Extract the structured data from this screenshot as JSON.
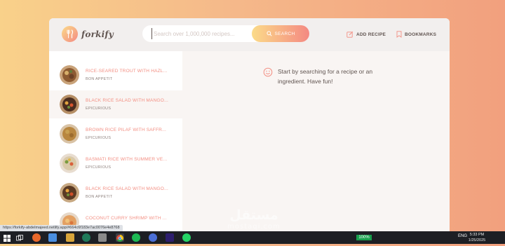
{
  "app": {
    "name": "forkify"
  },
  "search": {
    "placeholder": "Search over 1,000,000 recipes...",
    "button_label": "SEARCH"
  },
  "nav": {
    "add_recipe": "ADD RECIPE",
    "bookmarks": "BOOKMARKS"
  },
  "results": [
    {
      "title": "RICE-SEARED TROUT WITH HAZL...",
      "publisher": "BON APPETIT",
      "active": false
    },
    {
      "title": "BLACK RICE SALAD WITH MANGO...",
      "publisher": "EPICURIOUS",
      "active": true
    },
    {
      "title": "BROWN RICE PILAF WITH SAFFR...",
      "publisher": "EPICURIOUS",
      "active": false
    },
    {
      "title": "BASMATI RICE WITH SUMMER VE...",
      "publisher": "EPICURIOUS",
      "active": false
    },
    {
      "title": "BLACK RICE SALAD WITH MANGO...",
      "publisher": "BON APPETIT",
      "active": false
    },
    {
      "title": "COCONUT CURRY SHRIMP WITH ...",
      "publisher": "",
      "active": false
    }
  ],
  "message": "Start by searching for a recipe or an ingredient. Have fun!",
  "browser": {
    "status_url": "https://forkify-abdelmajeed.netlify.app/#664c6f183e7ac0076e4e8768"
  },
  "taskbar": {
    "battery": "100%",
    "time": "5:33 PM",
    "date": "1/25/2025",
    "lang": "ENG"
  },
  "watermark": {
    "arabic": "مستقل",
    "latin": "mostaqi.com"
  },
  "colors": {
    "accent_start": "#fbdb89",
    "accent_end": "#f48982",
    "text": "#615551"
  }
}
